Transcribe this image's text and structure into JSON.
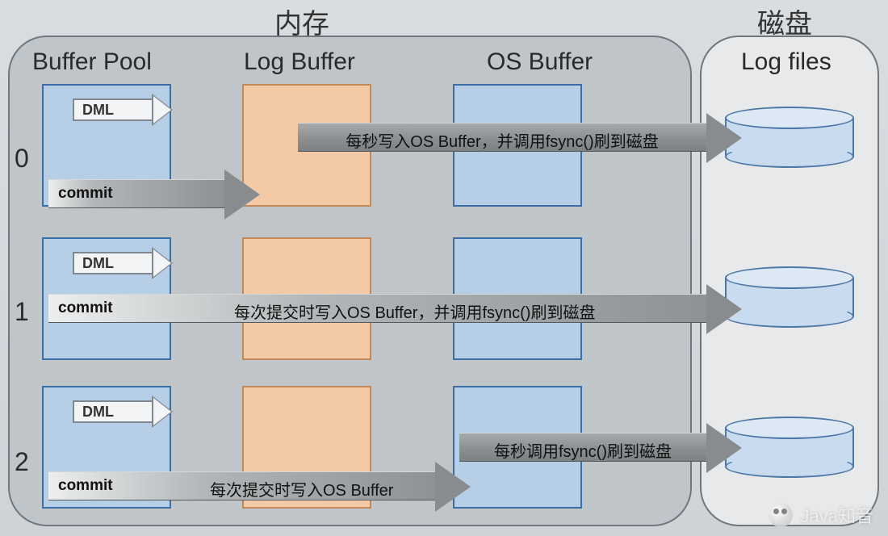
{
  "titles": {
    "memory": "内存",
    "disk": "磁盘"
  },
  "columns": {
    "buffer_pool": "Buffer Pool",
    "log_buffer": "Log Buffer",
    "os_buffer": "OS Buffer",
    "log_files": "Log files"
  },
  "rows": [
    {
      "setting": "0",
      "dml": "DML",
      "commit": "commit",
      "to_os_text": "每秒写入OS Buffer，并调用fsync()刷到磁盘"
    },
    {
      "setting": "1",
      "dml": "DML",
      "commit": "commit",
      "to_os_text": "每次提交时写入OS Buffer，并调用fsync()刷到磁盘"
    },
    {
      "setting": "2",
      "dml": "DML",
      "commit": "commit",
      "commit_text": "每次提交时写入OS Buffer",
      "fsync_text": "每秒调用fsync()刷到磁盘"
    }
  ],
  "watermark": "Java知音"
}
